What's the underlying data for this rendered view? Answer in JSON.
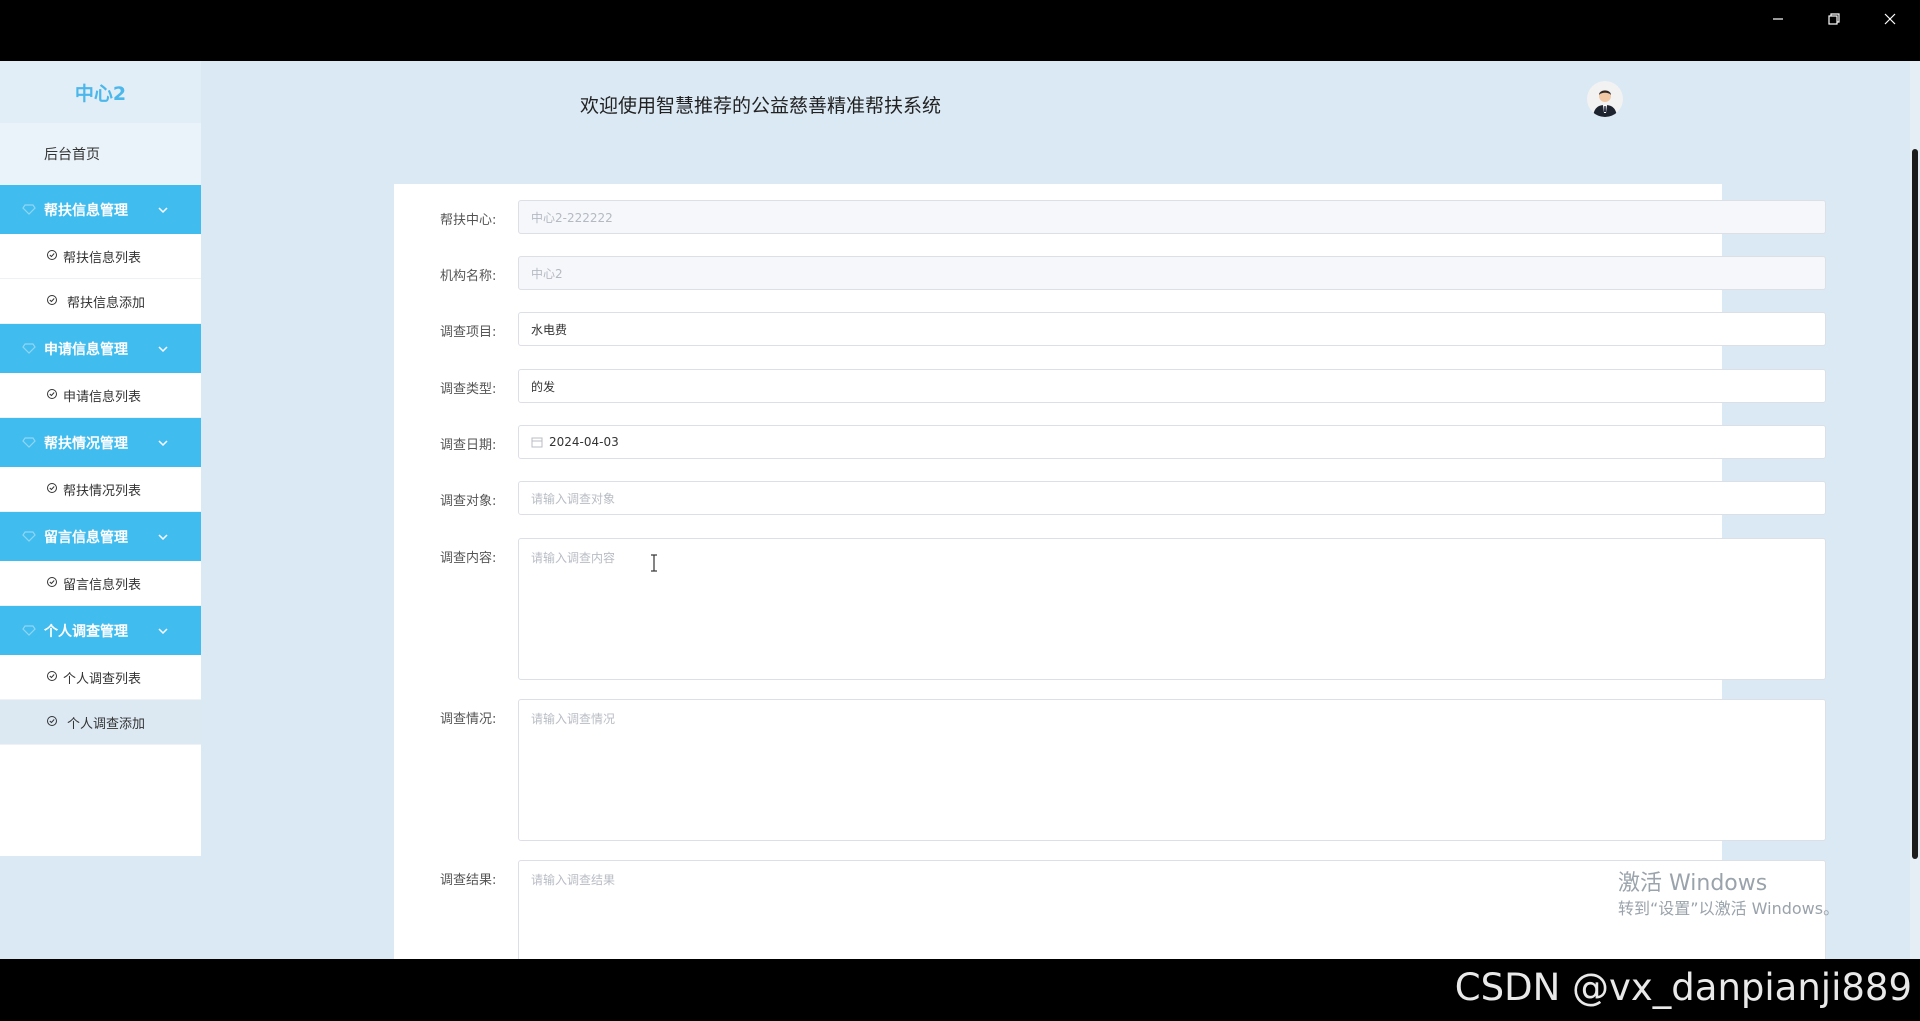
{
  "window": {
    "minimize_icon": "minimize-icon",
    "restore_icon": "restore-icon",
    "close_icon": "close-icon"
  },
  "sidebar": {
    "brand": "中心2",
    "home": "后台首页",
    "groups": [
      {
        "label": "帮扶信息管理",
        "items": [
          "帮扶信息列表",
          "帮扶信息添加"
        ]
      },
      {
        "label": "申请信息管理",
        "items": [
          "申请信息列表"
        ]
      },
      {
        "label": "帮扶情况管理",
        "items": [
          "帮扶情况列表"
        ]
      },
      {
        "label": "留言信息管理",
        "items": [
          "留言信息列表"
        ]
      },
      {
        "label": "个人调查管理",
        "items": [
          "个人调查列表",
          "个人调查添加"
        ]
      }
    ],
    "active_item": "个人调查添加"
  },
  "header": {
    "title": "欢迎使用智慧推荐的公益慈善精准帮扶系统"
  },
  "form": {
    "fields": [
      {
        "label": "帮扶中心:",
        "value": "中心2-222222",
        "state": "disabled"
      },
      {
        "label": "机构名称:",
        "value": "中心2",
        "state": "disabled"
      },
      {
        "label": "调查项目:",
        "value": "水电费",
        "state": "filled"
      },
      {
        "label": "调查类型:",
        "value": "的发",
        "state": "filled"
      },
      {
        "label": "调查日期:",
        "value": "2024-04-03",
        "state": "date"
      },
      {
        "label": "调查对象:",
        "placeholder": "请输入调查对象",
        "state": "placeholder"
      }
    ],
    "textareas": [
      {
        "label": "调查内容:",
        "placeholder": "请输入调查内容"
      },
      {
        "label": "调查情况:",
        "placeholder": "请输入调查情况"
      },
      {
        "label": "调查结果:",
        "placeholder": "请输入调查结果"
      }
    ]
  },
  "watermark": {
    "line1": "激活 Windows",
    "line2": "转到“设置”以激活 Windows。"
  },
  "footer_watermark": "CSDN @vx_danpianji889",
  "colors": {
    "accent": "#40bcef",
    "background": "#dbe9f4"
  }
}
